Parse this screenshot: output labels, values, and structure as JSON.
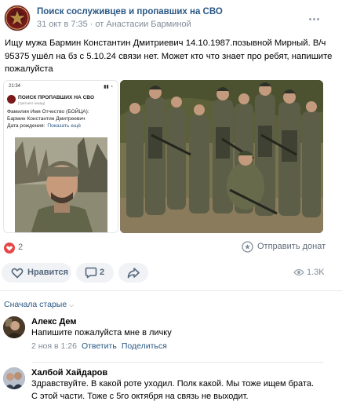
{
  "post": {
    "group_name": "Поиск сослуживцев и пропавших на СВО",
    "date": "31 окт в 7:35",
    "author": "от Анастасии Барминой",
    "text": "Ищу мужа Бармин Константин Дмитриевич 14.10.1987.позывной Мирный. В/ч 95375 ушёл на бз с 5.10.24 связи нет. Может кто что знает про ребят, напишите пожалуйста"
  },
  "screenshot_image": {
    "time": "21:34",
    "title": "ПОИСК ПРОПАВШИХ НА СВО",
    "subtitle": "(третьего назад)",
    "line1": "Фамилия Имя Отчество (БОЙЦА):",
    "line2": "Бармин Константин Дмитреевич",
    "line3": "Дата рождения:",
    "line3_link": "Показать ещё"
  },
  "reactions": {
    "likes_count": "2",
    "donate_label": "Отправить донат",
    "like_button_label": "Нравится",
    "comment_count": "2",
    "views": "1.3K"
  },
  "comments_sort": "Сначала старые",
  "comments": [
    {
      "name": "Алекс Дем",
      "text": "Напишите пожалуйста мне в личку",
      "date": "2 ноя в 1:26",
      "reply": "Ответить",
      "share": "Поделиться"
    },
    {
      "name": "Халбой Хайдаров",
      "text": "Здравствуйте. В какой роте уходил. Полк какой. Мы тоже ищем брата. С этой части. Тоже с 5го октября на связь не выходит."
    }
  ],
  "colors": {
    "link": "#2a5885",
    "secondary_text": "#818c99",
    "button_bg": "#f0f2f5",
    "heart": "#e64646"
  }
}
